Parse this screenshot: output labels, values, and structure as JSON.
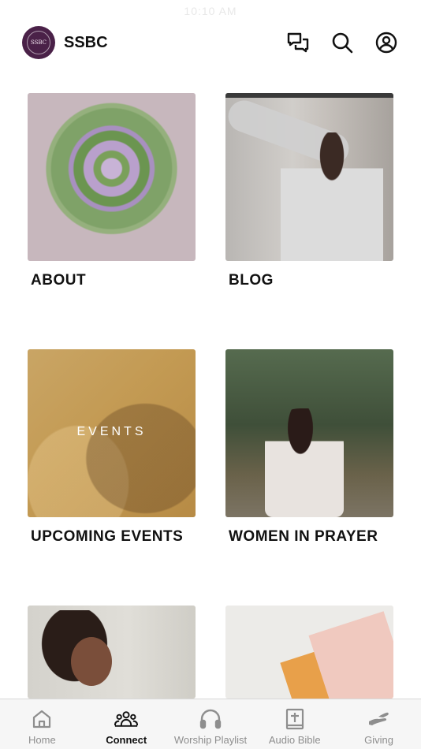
{
  "status_bar": {
    "time": "10:10 AM"
  },
  "header": {
    "logo_text": "SSBC",
    "title": "SSBC",
    "icons": [
      "chat-icon",
      "search-icon",
      "profile-icon"
    ]
  },
  "tiles": [
    {
      "label": "ABOUT"
    },
    {
      "label": "BLOG"
    },
    {
      "label": "UPCOMING EVENTS",
      "overlay_text": "EVENTS"
    },
    {
      "label": "WOMEN IN PRAYER"
    },
    {
      "label": ""
    },
    {
      "label": ""
    }
  ],
  "tabbar": {
    "active": "Connect",
    "tabs": [
      {
        "label": "Home",
        "icon": "home-icon"
      },
      {
        "label": "Connect",
        "icon": "people-icon"
      },
      {
        "label": "Worship Playlist",
        "icon": "headphones-icon"
      },
      {
        "label": "Audio Bible",
        "icon": "bible-icon"
      },
      {
        "label": "Giving",
        "icon": "giving-hand-icon"
      }
    ]
  },
  "colors": {
    "brand": "#4a2148",
    "active_tab": "#111111",
    "inactive_tab": "#8e8e8e"
  }
}
